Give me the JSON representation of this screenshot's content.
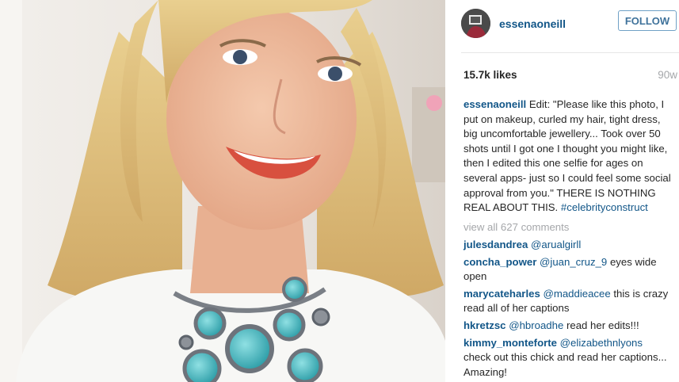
{
  "post": {
    "username": "essenaoneill",
    "follow_label": "FOLLOW",
    "likes": "15.7k likes",
    "time_ago": "90w",
    "caption_username": "essenaoneill",
    "caption_text": "Edit: \"Please like this photo, I put on makeup, curled my hair, tight dress, big uncomfortable jewellery... Took over 50 shots until I got one I thought you might like, then I edited this one selfie for ages on several apps- just so I could feel some social approval from you.\" THERE IS NOTHING REAL ABOUT THIS.",
    "caption_hashtag": "#celebrityconstruct",
    "view_all_comments": "view all 627 comments"
  },
  "comments": [
    {
      "user": "julesdandrea",
      "mention": "@arualgirll",
      "text": ""
    },
    {
      "user": "concha_power",
      "mention": "@juan_cruz_9",
      "text": "eyes wide open"
    },
    {
      "user": "marycateharles",
      "mention": "@maddieacee",
      "text": "this is crazy read all of her captions"
    },
    {
      "user": "hkretzsc",
      "mention": "@hbroadhe",
      "text": "read her edits!!!"
    },
    {
      "user": "kimmy_monteforte",
      "mention": "@elizabethnlyons",
      "text": "check out this chick and read her captions... Amazing!"
    }
  ],
  "colors": {
    "username": "#125688",
    "follow_border": "#70a1c6",
    "muted": "#a5a7aa"
  }
}
